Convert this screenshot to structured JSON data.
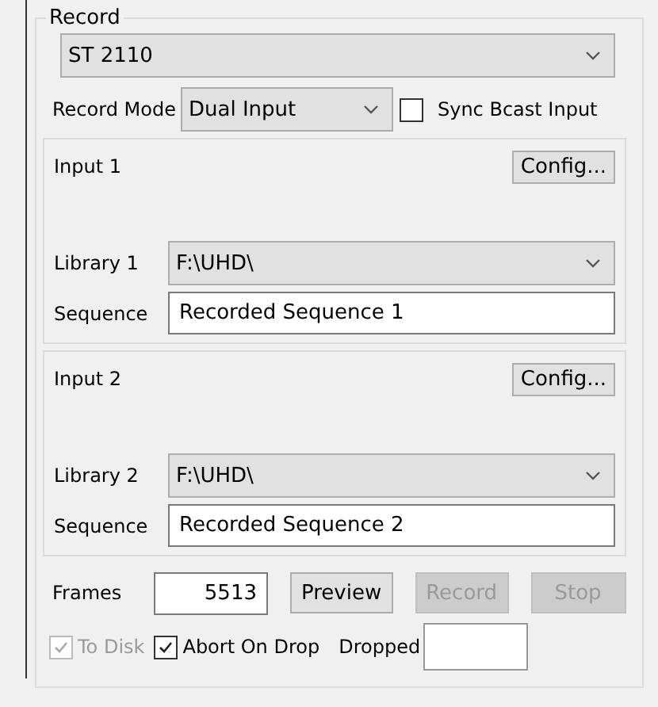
{
  "group": {
    "title": "Record"
  },
  "source": {
    "value": "ST 2110"
  },
  "record_mode": {
    "label": "Record Mode",
    "value": "Dual Input"
  },
  "sync_bcast": {
    "label": "Sync Bcast Input",
    "checked": false
  },
  "inputs": [
    {
      "title": "Input 1",
      "config": "Config...",
      "library_label": "Library 1",
      "library": "F:\\UHD\\",
      "sequence_label": "Sequence",
      "sequence": "Recorded Sequence 1"
    },
    {
      "title": "Input 2",
      "config": "Config...",
      "library_label": "Library 2",
      "library": "F:\\UHD\\",
      "sequence_label": "Sequence",
      "sequence": "Recorded Sequence 2"
    }
  ],
  "frames": {
    "label": "Frames",
    "value": "5513"
  },
  "buttons": [
    {
      "label": "Preview",
      "disabled": false
    },
    {
      "label": "Record",
      "disabled": true
    },
    {
      "label": "Stop",
      "disabled": true
    }
  ],
  "options": [
    {
      "label": "To Disk",
      "checked": true,
      "disabled": true
    },
    {
      "label": "Abort On Drop",
      "checked": true,
      "disabled": false
    }
  ],
  "dropped": {
    "label": "Dropped"
  }
}
